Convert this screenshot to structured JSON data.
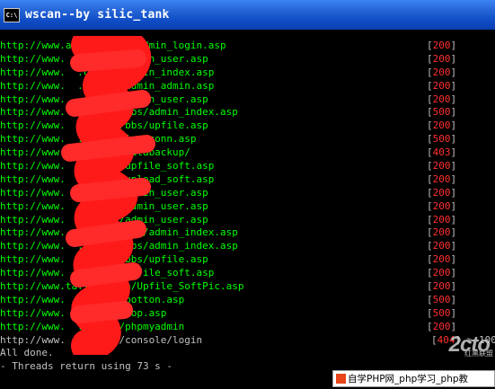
{
  "window": {
    "title": "wscan--by silic_tank",
    "icon_label": "C:\\"
  },
  "lines": [
    {
      "url": "http://www.a  7.com.cn/admin_login.asp",
      "status": "[200]",
      "kind": "ok"
    },
    {
      "url": "http://www.  .com.cn/admin_user.asp",
      "status": "[200]",
      "kind": "ok"
    },
    {
      "url": "http://www.  .com.cn/admin_index.asp",
      "status": "[200]",
      "kind": "ok"
    },
    {
      "url": "http://www.  .com.cn/admin_admin.asp",
      "status": "[200]",
      "kind": "ok"
    },
    {
      "url": "http://www.  .com.cn/admin_user.asp",
      "status": "[200]",
      "kind": "ok"
    },
    {
      "url": "http://www.  .com.cn/bbs/admin_index.asp",
      "status": "[500]",
      "kind": "err"
    },
    {
      "url": "http://www.  .com.cn/bbs/upfile.asp",
      "status": "[200]",
      "kind": "ok"
    },
    {
      "url": "http://www.  .com.cn/inc/conn.asp",
      "status": "[500]",
      "kind": "err"
    },
    {
      "url": "http://www.  .com.cn/databackup/",
      "status": "[403]",
      "kind": "ok"
    },
    {
      "url": "http://www.  .com.cn/upfile_soft.asp",
      "status": "[200]",
      "kind": "ok"
    },
    {
      "url": "http://www.  .com.cn/upload_soft.asp",
      "status": "[200]",
      "kind": "ok"
    },
    {
      "url": "http://www.  .com.cn/admin_user.asp",
      "status": "[200]",
      "kind": "ok"
    },
    {
      "url": "http://www.  .com.cn/admin_user.asp",
      "status": "[200]",
      "kind": "ok"
    },
    {
      "url": "http://www.  .com.cn/admin_user.asp",
      "status": "[200]",
      "kind": "ok"
    },
    {
      "url": "http://www.  .com.cn/bbs/admin_index.asp",
      "status": "[200]",
      "kind": "ok"
    },
    {
      "url": "http://www.  .com.cn/bbs/admin_index.asp",
      "status": "[200]",
      "kind": "ok"
    },
    {
      "url": "http://www.  .com.cn/bbs/upfile.asp",
      "status": "[200]",
      "kind": "ok"
    },
    {
      "url": "http://www.  .com.cn/upfile_soft.asp",
      "status": "[200]",
      "kind": "ok"
    },
    {
      "url": "http://www.tafl.com.cn/Upfile_SoftPic.asp",
      "status": "[200]",
      "kind": "ok"
    },
    {
      "url": "http://www.  .com.cn/botton.asp",
      "status": "[500]",
      "kind": "err"
    },
    {
      "url": "http://www.  .com.cn/top.asp",
      "status": "[500]",
      "kind": "err"
    },
    {
      "url": "http://www.  .com.cn/phpmyadmin",
      "status": "[200]",
      "kind": "ok"
    }
  ],
  "last_line": {
    "url": "http://www.  .com.cn/console/login",
    "status": "[404] > 100"
  },
  "done_line": "All done.",
  "threads_line": "- Threads return using 73 s -",
  "watermark": {
    "logo": "2cto",
    "sub": "红黑联盟",
    "bar_text": "自学PHP网_php学习_php教"
  },
  "colors": {
    "url": "#00ff00",
    "status_bracket": "#c0c0c0",
    "status_code": "#ff3030",
    "titlebar": "#0f4cc6",
    "redaction": "#ff1a1a"
  }
}
